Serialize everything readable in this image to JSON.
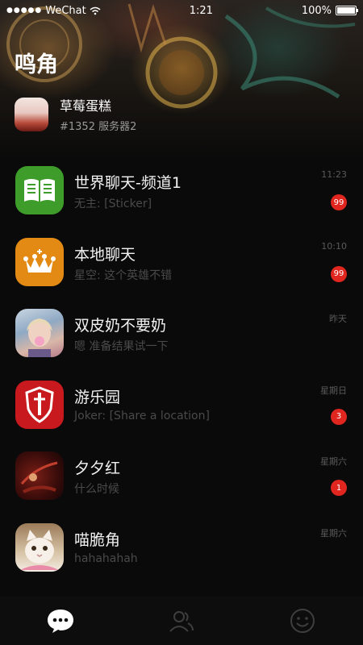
{
  "status_bar": {
    "carrier": "WeChat",
    "time": "1:21",
    "battery": "100%",
    "battery_level": 1.0
  },
  "header": {
    "title": "鸣角"
  },
  "server": {
    "name": "草莓蛋糕",
    "subtitle": "#1352 服务器2"
  },
  "chats": [
    {
      "name": "世界聊天-频道1",
      "preview": "无主: [Sticker]",
      "time": "11:23",
      "badge": "99",
      "avatar": "book-icon",
      "color": "#3d9c2a"
    },
    {
      "name": "本地聊天",
      "preview": "星空: 这个英雄不错",
      "time": "10:10",
      "badge": "99",
      "avatar": "crown-icon",
      "color": "#e38a14"
    },
    {
      "name": "双皮奶不要奶",
      "preview": "嗯 准备结果试一下",
      "time": "昨天",
      "badge": "",
      "avatar": "user-photo",
      "color": "#8fa9c4"
    },
    {
      "name": "游乐园",
      "preview": "Joker: [Share a location]",
      "time": "星期日",
      "badge": "3",
      "avatar": "sword-shield-icon",
      "color": "#c8191e"
    },
    {
      "name": "夕夕红",
      "preview": "什么时候",
      "time": "星期六",
      "badge": "1",
      "avatar": "red-art-photo",
      "color": "#4a1410"
    },
    {
      "name": "喵脆角",
      "preview": "hahahahah",
      "time": "星期六",
      "badge": "",
      "avatar": "cat-photo",
      "color": "#d7c3a6"
    }
  ],
  "tabbar": {
    "items": [
      "chat-bubble-icon",
      "contacts-icon",
      "smiley-icon"
    ],
    "active_color": "#ffffff",
    "inactive_color": "#3e3e3e"
  }
}
